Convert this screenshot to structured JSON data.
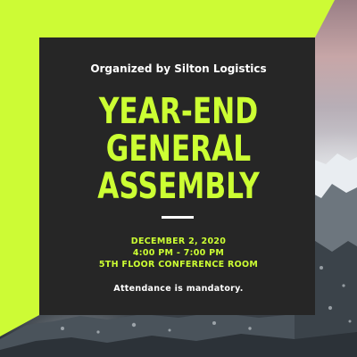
{
  "poster": {
    "organizer": "Organized by Silton Logistics",
    "title_lines": [
      "YEAR-END",
      "GENERAL",
      "ASSEMBLY"
    ],
    "date": "DECEMBER 2, 2020",
    "time": "4:00 PM - 7:00 PM",
    "location": "5TH FLOOR CONFERENCE ROOM",
    "note": "Attendance is mandatory."
  },
  "colors": {
    "accent": "#ccff33",
    "panel": "#262626",
    "text_white": "#ffffff"
  }
}
